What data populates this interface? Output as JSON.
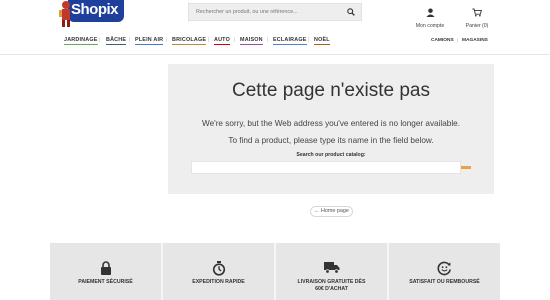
{
  "header": {
    "logo_text": "Shopix",
    "search_placeholder": "Rechercher un produit, ou une référence...",
    "account_label": "Mon compte",
    "cart_label": "Panier (0)"
  },
  "nav": {
    "items": [
      {
        "label": "JARDINAGE",
        "color": "#6aa84f"
      },
      {
        "label": "BÂCHE",
        "color": "#3d5a80"
      },
      {
        "label": "PLEIN AIR",
        "color": "#3c78d8"
      },
      {
        "label": "BRICOLAGE",
        "color": "#b58b3a"
      },
      {
        "label": "AUTO",
        "color": "#cc0000"
      },
      {
        "label": "MAISON",
        "color": "#9c4fa8"
      },
      {
        "label": "ECLAIRAGE",
        "color": "#4a86c8"
      },
      {
        "label": "NOËL",
        "color": "#b45f06"
      }
    ],
    "right_items": [
      "CAMIONS",
      "MAGASINS"
    ]
  },
  "panel": {
    "title": "Cette page n'existe pas",
    "message_1": "We're sorry, but the Web address you've entered is no longer available.",
    "message_2": "To find a product, please type its name in the field below.",
    "search_label": "Search our product catalog:"
  },
  "home_link": "← Home page",
  "footer": {
    "features": [
      {
        "label_1": "PAIEMENT SÉCURISÉ",
        "label_2": "",
        "icon": "lock-icon"
      },
      {
        "label_1": "EXPEDITION RAPIDE",
        "label_2": "",
        "icon": "stopwatch-icon"
      },
      {
        "label_1": "LIVRAISON GRATUITE DÈS",
        "label_2": "60€ D'ACHAT",
        "icon": "truck-icon"
      },
      {
        "label_1": "SATISFAIT OU REMBOURSÉ",
        "label_2": "",
        "icon": "refund-icon"
      }
    ]
  },
  "colors": {
    "brand_blue": "#1f3f9c",
    "accent_orange": "#f0a040",
    "panel_bg": "#eeeeee"
  }
}
